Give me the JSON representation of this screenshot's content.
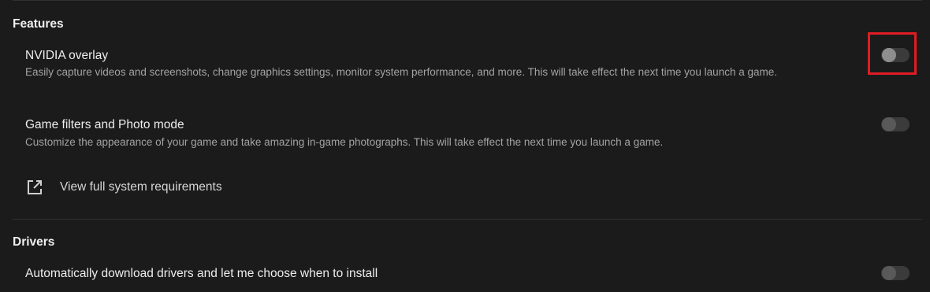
{
  "features": {
    "title": "Features",
    "items": [
      {
        "title": "NVIDIA overlay",
        "description": "Easily capture videos and screenshots, change graphics settings, monitor system performance, and more. This will take effect the next time you launch a game.",
        "enabled": false
      },
      {
        "title": "Game filters and Photo mode",
        "description": "Customize the appearance of your game and take amazing in-game photographs. This will take effect the next time you launch a game.",
        "enabled": false
      }
    ],
    "link": {
      "label": "View full system requirements",
      "icon": "external-link-icon"
    }
  },
  "drivers": {
    "title": "Drivers",
    "items": [
      {
        "title": "Automatically download drivers and let me choose when to install",
        "enabled": false
      }
    ]
  },
  "colors": {
    "background": "#1b1b1b",
    "highlight": "#e01c24"
  }
}
